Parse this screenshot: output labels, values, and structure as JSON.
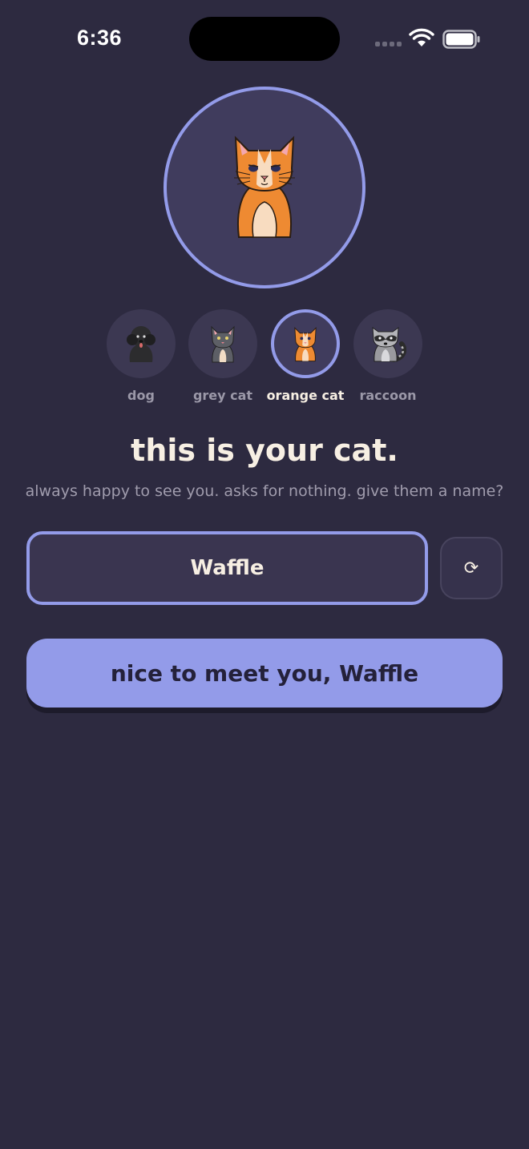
{
  "status_bar": {
    "time": "6:36"
  },
  "hero": {
    "avatar_icon": "orange-cat-icon"
  },
  "pets": [
    {
      "label": "dog",
      "icon": "dog-icon",
      "selected": false
    },
    {
      "label": "grey cat",
      "icon": "grey-cat-icon",
      "selected": false
    },
    {
      "label": "orange cat",
      "icon": "orange-cat-icon",
      "selected": true
    },
    {
      "label": "raccoon",
      "icon": "raccoon-icon",
      "selected": false
    }
  ],
  "intro": {
    "title": "this is your cat.",
    "subtitle": "always happy to see you. asks for nothing. give them a name?"
  },
  "name_field": {
    "value": "Waffle"
  },
  "reroll": {
    "icon": "refresh-icon",
    "glyph": "⟳"
  },
  "cta": {
    "label": "nice to meet you, Waffle"
  },
  "colors": {
    "background": "#2d2a40",
    "accent": "#939be9",
    "text_light": "#f7efe3",
    "text_muted": "#a09cad"
  }
}
